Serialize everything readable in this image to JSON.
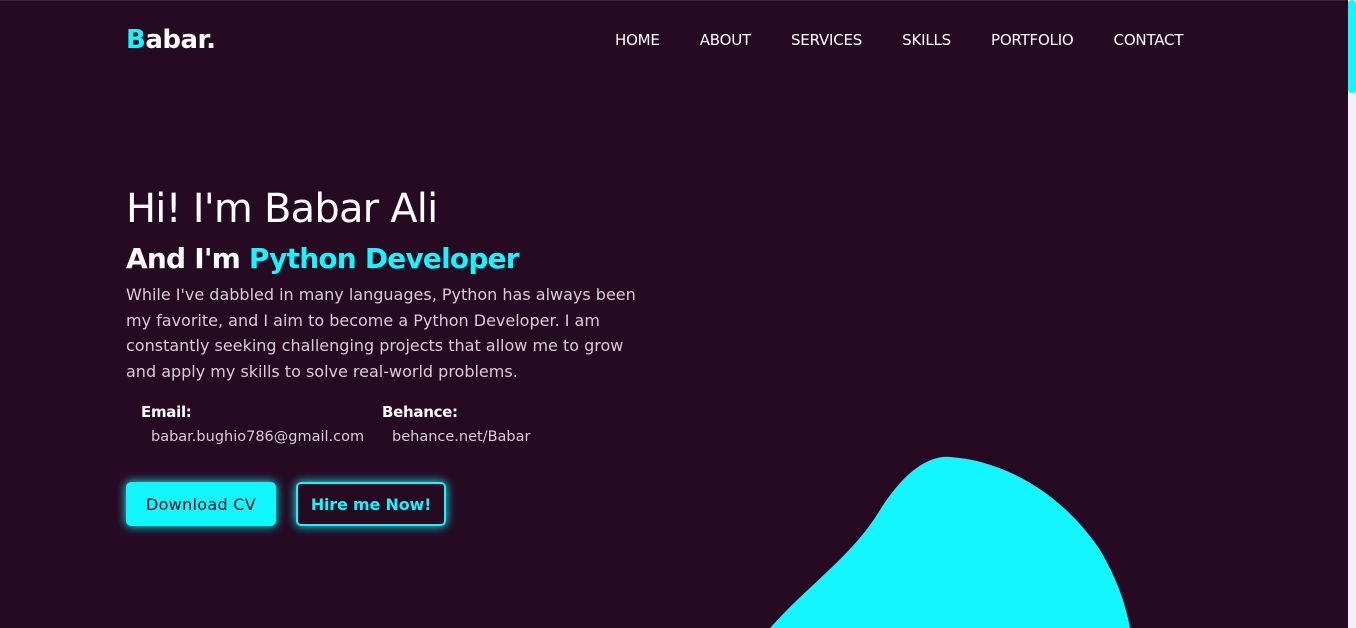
{
  "brand": {
    "logo_initial": "B",
    "logo_rest": "abar."
  },
  "nav": {
    "items": [
      "HOME",
      "ABOUT",
      "SERVICES",
      "SKILLS",
      "PORTFOLIO",
      "CONTACT"
    ]
  },
  "hero": {
    "title": "Hi! I'm Babar Ali",
    "subtitle_prefix": "And I'm ",
    "subtitle_role": "Python Developer",
    "description": "While I've dabbled in many languages, Python has always been my favorite, and I aim to become a Python Developer. I am constantly seeking challenging projects that allow me to grow and apply my skills to solve real-world problems."
  },
  "contacts": {
    "email_label": "Email:",
    "email_value": "babar.bughio786@gmail.com",
    "behance_label": "Behance:",
    "behance_value": "behance.net/Babar"
  },
  "buttons": {
    "download_cv": "Download CV",
    "hire_me": "Hire me Now!"
  },
  "colors": {
    "background": "#250a22",
    "accent": "#12f7ff",
    "text": "#ffffff",
    "muted_text": "#d9ccd6"
  }
}
